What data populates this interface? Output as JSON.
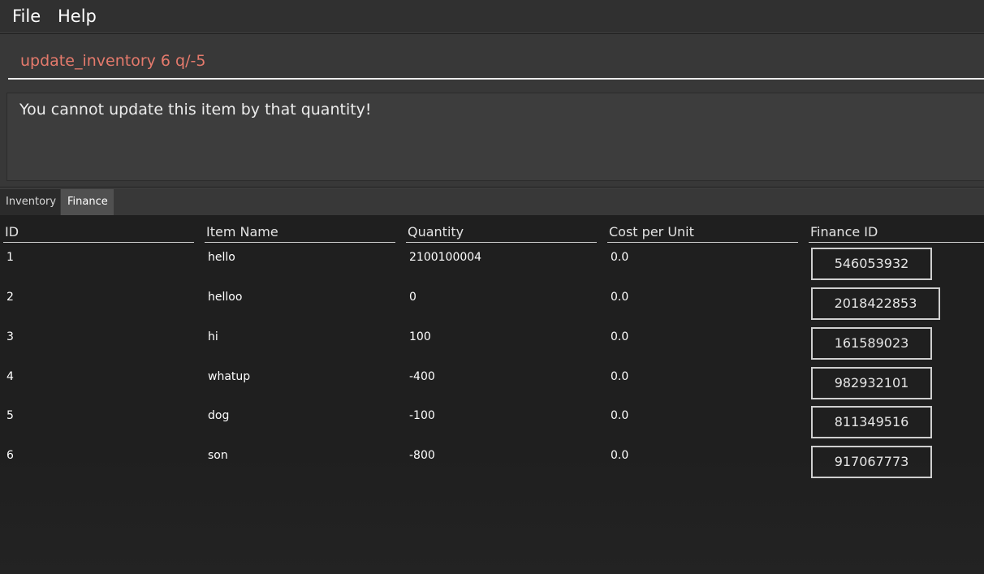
{
  "menu": {
    "file_label": "File",
    "help_label": "Help"
  },
  "command_box": {
    "value": "update_inventory 6 q/-5"
  },
  "result_display": {
    "message": "You cannot update this item by that quantity!"
  },
  "tabs": [
    {
      "label": "Inventory",
      "selected": true
    },
    {
      "label": "Finance",
      "selected": false
    }
  ],
  "table": {
    "columns": [
      "ID",
      "Item Name",
      "Quantity",
      "Cost per Unit",
      "Finance ID"
    ],
    "rows": [
      {
        "id": "1",
        "name": "hello",
        "quantity": "2100100004",
        "cost": "0.0",
        "finance_id": "546053932"
      },
      {
        "id": "2",
        "name": "helloo",
        "quantity": "0",
        "cost": "0.0",
        "finance_id": "2018422853"
      },
      {
        "id": "3",
        "name": "hi",
        "quantity": "100",
        "cost": "0.0",
        "finance_id": "161589023"
      },
      {
        "id": "4",
        "name": "whatup",
        "quantity": "-400",
        "cost": "0.0",
        "finance_id": "982932101"
      },
      {
        "id": "5",
        "name": "dog",
        "quantity": "-100",
        "cost": "0.0",
        "finance_id": "811349516"
      },
      {
        "id": "6",
        "name": "son",
        "quantity": "-800",
        "cost": "0.0",
        "finance_id": "917067773"
      }
    ]
  },
  "colors": {
    "command_text": "#e57a6c",
    "background": "#1f1f1f",
    "panel": "#383838"
  }
}
